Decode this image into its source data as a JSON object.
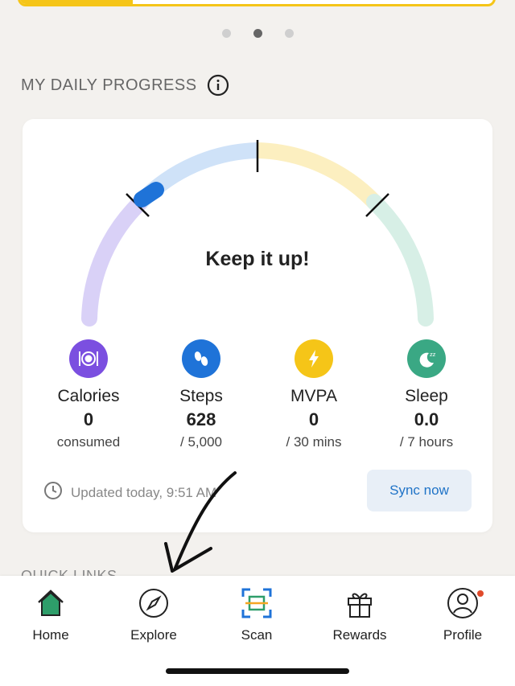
{
  "carousel": {
    "count": 3,
    "active_index": 1
  },
  "section_title": "MY DAILY PROGRESS",
  "progress_card": {
    "message": "Keep it up!",
    "gauge": {
      "segment_colors": [
        "#d9d1f7",
        "#cfe2f8",
        "#fcefc0",
        "#d7efe6"
      ],
      "indicator_color": "#1f73d8",
      "progress_fraction": 0.12
    },
    "metrics": [
      {
        "label": "Calories",
        "value": "0",
        "sub": "consumed",
        "icon": "plate-icon",
        "color": "#7b4fe0"
      },
      {
        "label": "Steps",
        "value": "628",
        "sub": "/ 5,000",
        "icon": "footprints-icon",
        "color": "#1f73d8"
      },
      {
        "label": "MVPA",
        "value": "0",
        "sub": "/ 30 mins",
        "icon": "lightning-icon",
        "color": "#f5c518"
      },
      {
        "label": "Sleep",
        "value": "0.0",
        "sub": "/ 7 hours",
        "icon": "moon-icon",
        "color": "#3aa884"
      }
    ],
    "updated_text": "Updated today, 9:51 AM",
    "sync_label": "Sync now"
  },
  "quick_links_title": "QUICK LINKS",
  "tabbar": [
    {
      "label": "Home",
      "icon": "home-icon",
      "active": true
    },
    {
      "label": "Explore",
      "icon": "compass-icon",
      "active": false
    },
    {
      "label": "Scan",
      "icon": "scan-icon",
      "active": false
    },
    {
      "label": "Rewards",
      "icon": "gift-icon",
      "active": false
    },
    {
      "label": "Profile",
      "icon": "profile-icon",
      "active": false,
      "badge": true
    }
  ],
  "colors": {
    "accent": "#f5c518",
    "primary": "#1f73c7",
    "home_green": "#2e9e6a"
  }
}
